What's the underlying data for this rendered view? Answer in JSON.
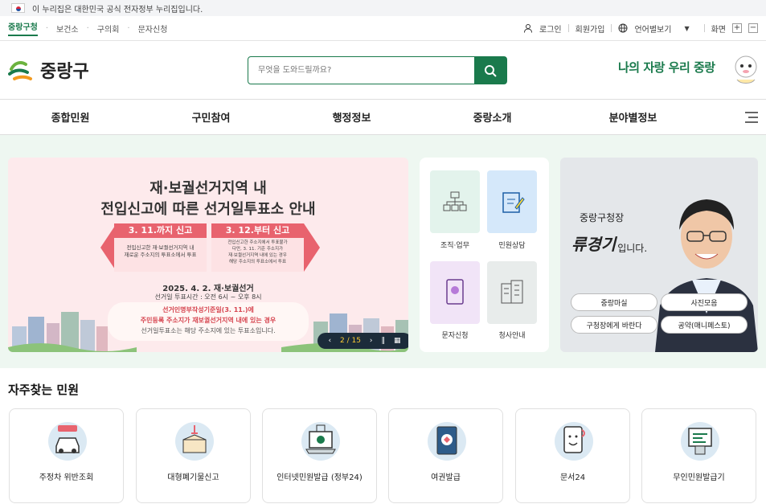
{
  "gov_notice": "이 누리집은 대한민국 공식 전자정부 누리집입니다.",
  "sites": [
    "중랑구청",
    "보건소",
    "구의회",
    "문자신청"
  ],
  "util": {
    "login": "로그인",
    "join": "회원가입",
    "lang": "언어별보기",
    "screen": "화면",
    "zoom_in": "+",
    "zoom_out": "−"
  },
  "header": {
    "logo": "중랑구",
    "search_placeholder": "무엇을 도와드릴까요?",
    "slogan": "나의 자랑 우리 중랑"
  },
  "gnb": [
    "종합민원",
    "구민참여",
    "행정정보",
    "중랑소개",
    "분야별정보"
  ],
  "banner": {
    "title1": "재·보궐선거지역 내",
    "title2": "전입신고에 따른 선거일투표소 안내",
    "left_head": "3. 11.까지 신고",
    "left_body": "전입신고한 재·보궐선거지역 내\n재로운 주소지의 투표소에서 투표",
    "right_head": "3. 12.부터 신고",
    "right_body": "전입신고한 주소지에서 투표불가\n다만, 3. 11. 기준 주소지가\n재·보궐선거지역 내에 있는 경우\n해당 주소지의 투표소에서 투표",
    "date": "2025. 4. 2. 재·보궐선거",
    "time": "선거일 투표시간 : 오전 6시 ~ 오후 8시",
    "note1": "선거인명부작성기준일(3. 11.)에",
    "note2": "주민등록 주소지가 재보궐선거지역 내에 있는 경우",
    "note3": "선거일투표소는 해당 주소지에 있는 투표소입니다.",
    "page": "2 / 15"
  },
  "quick": [
    {
      "label": "조직·업무"
    },
    {
      "label": "민원상담"
    },
    {
      "label": "문자신청"
    },
    {
      "label": "청사안내"
    }
  ],
  "mayor": {
    "title": "중랑구청장",
    "name": "류경기",
    "suffix": "입니다.",
    "links": [
      "중랑마실",
      "사진모음",
      "구청장에게 바란다",
      "공약(매니페스토)"
    ]
  },
  "section_title": "자주찾는 민원",
  "services": [
    "주정차 위반조회",
    "대형폐기물신고",
    "인터넷민원발급 (정부24)",
    "여권발급",
    "문서24",
    "무인민원발급기"
  ],
  "colors": {
    "accent": "#1a7a4c",
    "banner_bg": "#fdeaec",
    "banner_red": "#e8636e"
  }
}
